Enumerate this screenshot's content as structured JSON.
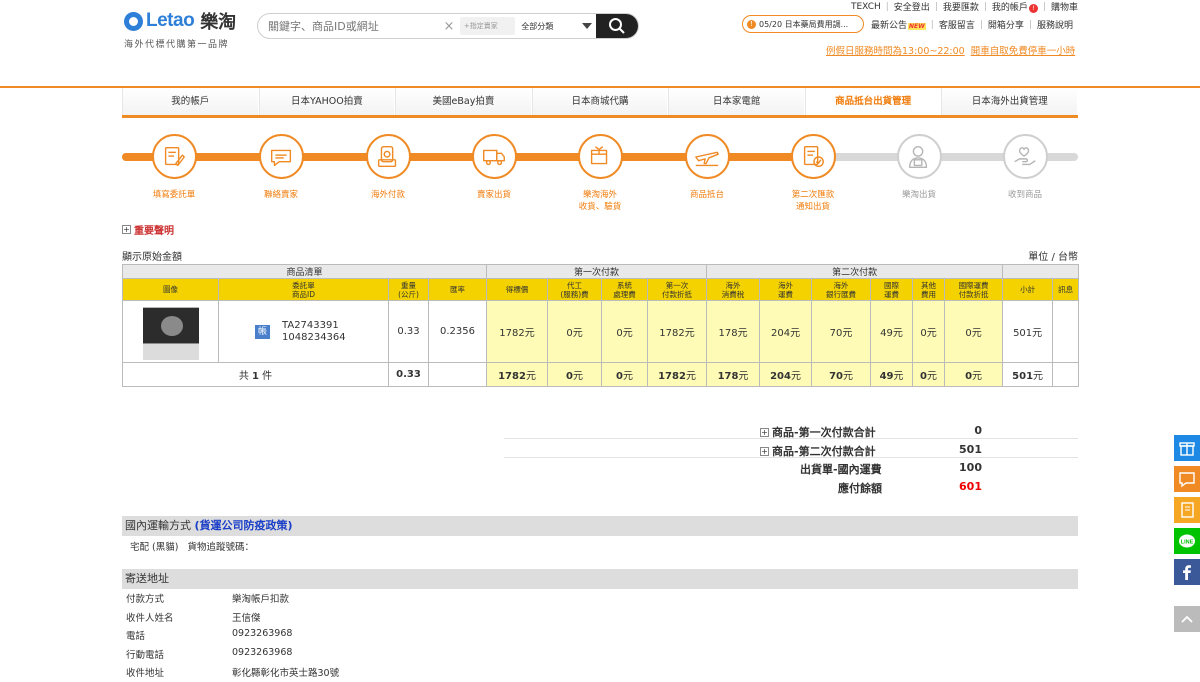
{
  "header": {
    "logo_text": "Letao",
    "logo_cn": "樂淘",
    "logo_tagline": "海外代標代購第一品牌",
    "search_placeholder": "關鍵字、商品ID或網址",
    "search_store_placeholder": "+指定賣家",
    "search_category": "全部分類",
    "top_links": [
      "TEXCH",
      "安全登出",
      "我要匯款",
      "我的帳戶",
      "購物車"
    ],
    "account_badge": "!",
    "notice": "05/20 日本藥局費用調...",
    "links_row2": [
      "最新公告",
      "客服留言",
      "開箱分享",
      "服務說明"
    ],
    "new_tag": "NEW",
    "hours_1": "例假日服務時間為13:00~22:00",
    "hours_2": "開車自取免費停車一小時"
  },
  "tabs": [
    "我的帳戶",
    "日本YAHOO拍賣",
    "美國eBay拍賣",
    "日本商城代購",
    "日本家電館",
    "商品抵台出貨管理",
    "日本海外出貨管理"
  ],
  "active_tab": 5,
  "steps": [
    {
      "label": "填寫委託單",
      "icon": "form-edit-icon",
      "done": true
    },
    {
      "label": "聯絡賣家",
      "icon": "chat-bubble-icon",
      "done": true
    },
    {
      "label": "海外付款",
      "icon": "payment-icon",
      "done": true
    },
    {
      "label": "賣家出貨",
      "icon": "delivery-truck-icon",
      "done": true
    },
    {
      "label": "樂淘海外\n收貨、驗貨",
      "icon": "package-check-icon",
      "done": true
    },
    {
      "label": "商品抵台",
      "icon": "airplane-icon",
      "done": true
    },
    {
      "label": "第二次匯款\n通知出貨",
      "icon": "invoice-check-icon",
      "done": true
    },
    {
      "label": "樂淘出貨",
      "icon": "courier-icon",
      "done": false
    },
    {
      "label": "收到商品",
      "icon": "hand-heart-icon",
      "done": false
    }
  ],
  "important_notice": "重要聲明",
  "show_original": "顯示原始金額",
  "unit": "單位 / 台幣",
  "table": {
    "group_headers": [
      "商品清單",
      "第一次付款",
      "第二次付款"
    ],
    "columns": [
      "圖像",
      "委託單\n商品ID",
      "重量\n(公斤)",
      "匯率",
      "得標價",
      "代工\n(服務)費",
      "系統\n處理費",
      "第一次\n付款折抵",
      "海外\n消費稅",
      "海外\n運費",
      "海外\n銀行匯費",
      "國際\n運費",
      "其他\n費用",
      "國際運費\n付款折抵",
      "小計",
      "訊息"
    ],
    "rows": [
      {
        "badge": "帳",
        "order_id": "TA2743391",
        "product_id": "1048234364",
        "weight": "0.33",
        "rate": "0.2356",
        "winning_bid": "1782元",
        "service_fee": "0元",
        "system_fee": "0元",
        "first_deduct": "1782元",
        "overseas_tax": "178元",
        "overseas_shipping": "204元",
        "bank_fee": "70元",
        "intl_shipping": "49元",
        "other_fee": "0元",
        "intl_deduct": "0元",
        "subtotal": "501元",
        "message": ""
      }
    ],
    "total": {
      "label_pre": "共",
      "count": "1",
      "label_post": "件",
      "weight": "0.33",
      "winning_bid": "1782",
      "service_fee": "0",
      "system_fee": "0",
      "first_deduct": "1782",
      "overseas_tax": "178",
      "overseas_shipping": "204",
      "bank_fee": "70",
      "intl_shipping": "49",
      "other_fee": "0",
      "intl_deduct": "0",
      "subtotal": "501",
      "currency": "元"
    }
  },
  "summary": [
    {
      "label": "商品-第一次付款合計",
      "value": "0",
      "expandable": true
    },
    {
      "label": "商品-第二次付款合計",
      "value": "501",
      "expandable": true
    },
    {
      "label": "出貨單-國內運費",
      "value": "100",
      "expandable": false
    },
    {
      "label": "應付餘額",
      "value": "601",
      "expandable": false,
      "highlight": "#e00000"
    }
  ],
  "domestic": {
    "title": "國內運輸方式",
    "policy_link": "(貨運公司防疫政策)",
    "method": "宅配 (黑貓)",
    "tracking_label": "貨物追蹤號碼："
  },
  "address": {
    "title": "寄送地址",
    "fields": [
      {
        "k": "付款方式",
        "v": "樂淘帳戶扣款"
      },
      {
        "k": "收件人姓名",
        "v": "王信傑"
      },
      {
        "k": "電話",
        "v": "0923263968"
      },
      {
        "k": "行動電話",
        "v": "0923263968"
      },
      {
        "k": "收件地址",
        "v": "彰化縣彰化市英士路30號"
      }
    ]
  },
  "side_widgets": [
    {
      "name": "gift-icon",
      "color": "#1e88e5"
    },
    {
      "name": "message-icon",
      "color": "#f08a24"
    },
    {
      "name": "notebook-icon",
      "color": "#f5a623"
    },
    {
      "name": "line-icon",
      "color": "#00c300"
    },
    {
      "name": "facebook-icon",
      "color": "#3b5998"
    },
    {
      "name": "scroll-top-icon",
      "color": "#bbbbbb"
    }
  ],
  "colors": {
    "accent": "#f08a24",
    "table_header": "#f3d200",
    "row_highlight": "#fdfbb5"
  }
}
